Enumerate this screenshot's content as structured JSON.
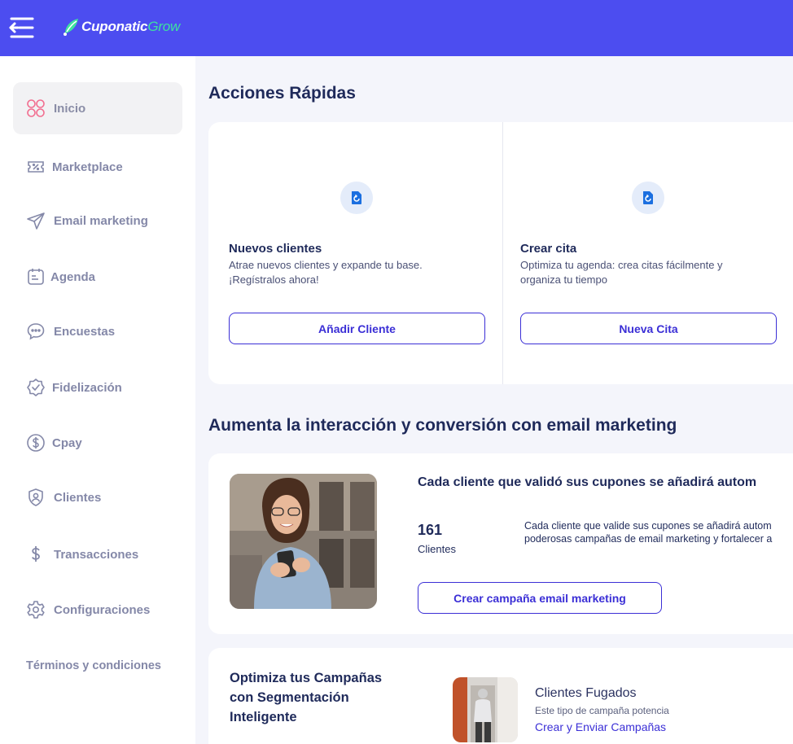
{
  "header": {
    "brand_part1": "Cuponatic",
    "brand_part2": "Grow",
    "colors": {
      "bar": "#4c4df0",
      "accent_green": "#3ee0a0"
    }
  },
  "sidebar": {
    "items": [
      {
        "label": "Inicio",
        "icon": "grid-icon",
        "active": true
      },
      {
        "label": "Marketplace",
        "icon": "ticket-icon"
      },
      {
        "label": "Email marketing",
        "icon": "send-icon"
      },
      {
        "label": "Agenda",
        "icon": "calendar-icon"
      },
      {
        "label": "Encuestas",
        "icon": "chat-bubble-icon"
      },
      {
        "label": "Fidelización",
        "icon": "badge-check-icon"
      },
      {
        "label": "Cpay",
        "icon": "dollar-circle-icon"
      },
      {
        "label": "Clientes",
        "icon": "user-shield-icon"
      },
      {
        "label": "Transacciones",
        "icon": "dollar-icon"
      },
      {
        "label": "Configuraciones",
        "icon": "gear-icon"
      }
    ],
    "terms": "Términos y condiciones"
  },
  "quick_actions": {
    "title": "Acciones Rápidas",
    "items": [
      {
        "icon": "sync-document-icon",
        "title": "Nuevos clientes",
        "desc_line1": "Atrae nuevos clientes y expande tu base.",
        "desc_line2": "¡Regístralos ahora!",
        "button": "Añadir Cliente"
      },
      {
        "icon": "sync-document-icon",
        "title": "Crear cita",
        "desc_line1": "Optimiza tu agenda: crea citas fácilmente y",
        "desc_line2": "organiza tu tiempo",
        "button": "Nueva Cita"
      }
    ]
  },
  "email_marketing": {
    "title": "Aumenta la interacción y conversión con email marketing",
    "heading": "Cada cliente que validó sus cupones se añadirá autom",
    "stat_value": "161",
    "stat_label": "Clientes",
    "desc_line1": "Cada cliente que valide sus cupones se añadirá autom",
    "desc_line2": "poderosas campañas de email marketing y fortalecer a",
    "button": "Crear campaña email marketing"
  },
  "segmentation": {
    "title_line1": "Optimiza tus Campañas",
    "title_line2": "con Segmentación",
    "title_line3": "Inteligente",
    "campaign_name": "Clientes Fugados",
    "campaign_sub": "Este tipo de campaña potencia",
    "campaign_link": "Crear y Enviar Campañas"
  }
}
